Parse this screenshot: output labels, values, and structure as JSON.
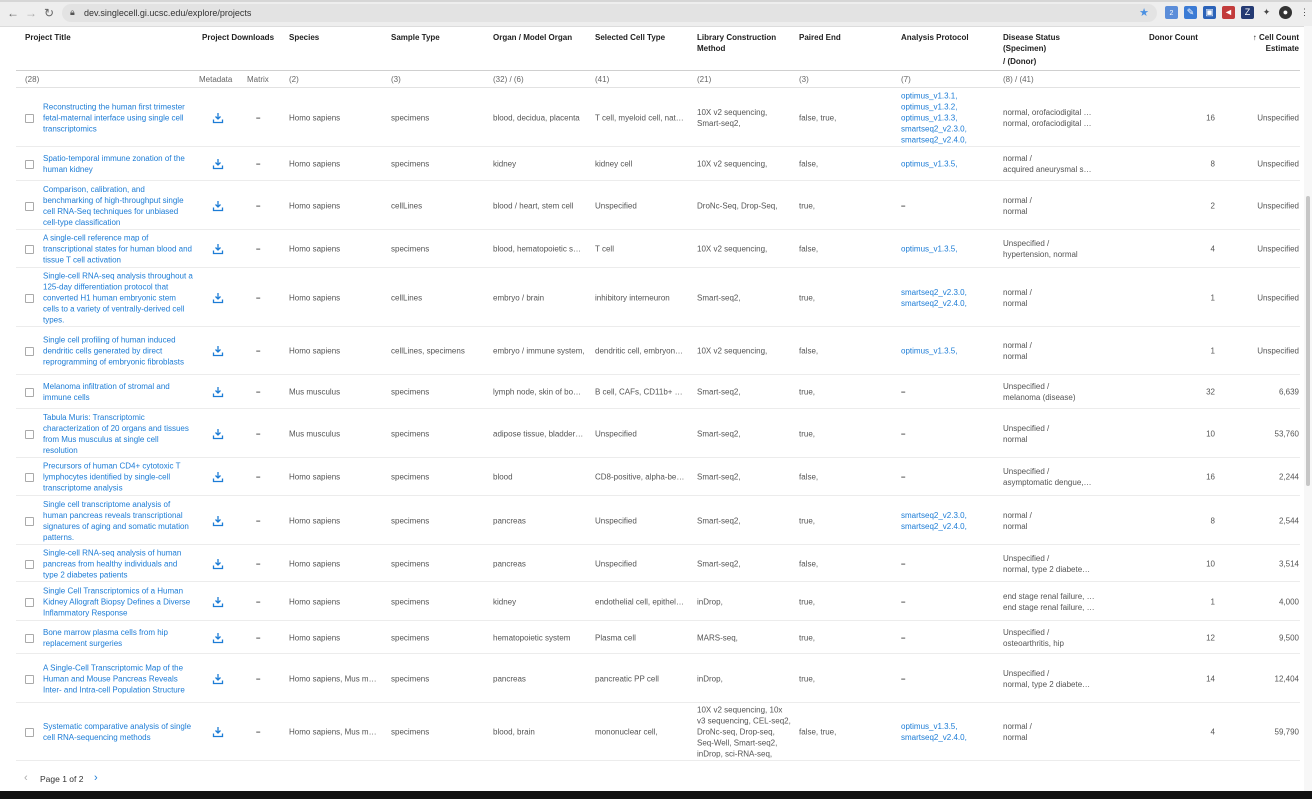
{
  "browser": {
    "url": "dev.singlecell.gi.ucsc.edu/explore/projects",
    "extension_badge": "2"
  },
  "table": {
    "headers": {
      "title": "Project Title",
      "downloads": "Project Downloads",
      "species": "Species",
      "sample_type": "Sample Type",
      "organ": "Organ / Model Organ",
      "cell_type": "Selected Cell Type",
      "library_line1": "Library Construction",
      "library_line2": "Method",
      "paired_end": "Paired End",
      "analysis": "Analysis Protocol",
      "disease_line1": "Disease Status",
      "disease_line2": "(Specimen)",
      "disease_line3": "/ (Donor)",
      "donor_count": "Donor Count",
      "cell_count_line1": "Cell Count",
      "cell_count_line2": "Estimate",
      "sort_arrow": "↑"
    },
    "subheaders": {
      "title": "(28)",
      "metadata": "Metadata",
      "matrix": "Matrix",
      "species": "(2)",
      "sample_type": "(3)",
      "organ": "(32) / (6)",
      "cell_type": "(41)",
      "library": "(21)",
      "paired_end": "(3)",
      "analysis": "(7)",
      "disease": "(8) / (41)"
    },
    "rows": [
      {
        "title": "Reconstructing the human first trimester fetal-maternal interface using single cell transcriptomics",
        "matrix": "–",
        "species": "Homo sapiens",
        "sample_type": "specimens",
        "organ": "blood, decidua, placenta",
        "cell_type": "T cell, myeloid cell, nat…",
        "library": "10X v2 sequencing, Smart-seq2,",
        "paired_end": "false, true,",
        "analysis": "optimus_v1.3.1, optimus_v1.3.2, optimus_v1.3.3, smartseq2_v2.3.0, smartseq2_v2.4.0,",
        "disease_a": "normal, orofaciodigital …",
        "disease_b": "normal, orofaciodigital …",
        "donors": "16",
        "cells": "Unspecified"
      },
      {
        "title": "Spatio-temporal immune zonation of the human kidney",
        "matrix": "–",
        "species": "Homo sapiens",
        "sample_type": "specimens",
        "organ": "kidney",
        "cell_type": "kidney cell",
        "library": "10X v2 sequencing,",
        "paired_end": "false,",
        "analysis": "optimus_v1.3.5,",
        "disease_a": "normal /",
        "disease_b": "acquired aneurysmal s…",
        "donors": "8",
        "cells": "Unspecified"
      },
      {
        "title": "Comparison, calibration, and benchmarking of high-throughput single cell RNA-Seq techniques for unbiased cell-type classification",
        "matrix": "–",
        "species": "Homo sapiens",
        "sample_type": "cellLines",
        "organ": "blood / heart, stem cell",
        "cell_type": "Unspecified",
        "library": "DroNc-Seq, Drop-Seq,",
        "paired_end": "true,",
        "analysis": "–",
        "disease_a": "normal /",
        "disease_b": "normal",
        "donors": "2",
        "cells": "Unspecified"
      },
      {
        "title": "A single-cell reference map of transcriptional states for human blood and tissue T cell activation",
        "matrix": "–",
        "species": "Homo sapiens",
        "sample_type": "specimens",
        "organ": "blood, hematopoietic s…",
        "cell_type": "T cell",
        "library": "10X v2 sequencing,",
        "paired_end": "false,",
        "analysis": "optimus_v1.3.5,",
        "disease_a": "Unspecified /",
        "disease_b": "hypertension, normal",
        "donors": "4",
        "cells": "Unspecified"
      },
      {
        "title": "Single-cell RNA-seq analysis throughout a 125-day differentiation protocol that converted H1 human embryonic stem cells to a variety of ventrally-derived cell types.",
        "matrix": "–",
        "species": "Homo sapiens",
        "sample_type": "cellLines",
        "organ": "embryo / brain",
        "cell_type": "inhibitory interneuron",
        "library": "Smart-seq2,",
        "paired_end": "true,",
        "analysis": "smartseq2_v2.3.0, smartseq2_v2.4.0,",
        "disease_a": "normal /",
        "disease_b": "normal",
        "donors": "1",
        "cells": "Unspecified"
      },
      {
        "title": "Single cell profiling of human induced dendritic cells generated by direct reprogramming of embryonic fibroblasts",
        "matrix": "–",
        "species": "Homo sapiens",
        "sample_type": "cellLines, specimens",
        "organ": "embryo / immune system,",
        "cell_type": "dendritic cell, embryon…",
        "library": "10X v2 sequencing,",
        "paired_end": "false,",
        "analysis": "optimus_v1.3.5,",
        "disease_a": "normal /",
        "disease_b": "normal",
        "donors": "1",
        "cells": "Unspecified"
      },
      {
        "title": "Melanoma infiltration of stromal and immune cells",
        "matrix": "–",
        "species": "Mus musculus",
        "sample_type": "specimens",
        "organ": "lymph node, skin of bo…",
        "cell_type": "B cell, CAFs, CD11b+ Ma…",
        "library": "Smart-seq2,",
        "paired_end": "true,",
        "analysis": "–",
        "disease_a": "Unspecified /",
        "disease_b": "melanoma (disease)",
        "donors": "32",
        "cells": "6,639"
      },
      {
        "title": "Tabula Muris: Transcriptomic characterization of 20 organs and tissues from Mus musculus at single cell resolution",
        "matrix": "–",
        "species": "Mus musculus",
        "sample_type": "specimens",
        "organ": "adipose tissue, bladder…",
        "cell_type": "Unspecified",
        "library": "Smart-seq2,",
        "paired_end": "true,",
        "analysis": "–",
        "disease_a": "Unspecified /",
        "disease_b": "normal",
        "donors": "10",
        "cells": "53,760"
      },
      {
        "title": "Precursors of human CD4+ cytotoxic T lymphocytes identified by single-cell transcriptome analysis",
        "matrix": "–",
        "species": "Homo sapiens",
        "sample_type": "specimens",
        "organ": "blood",
        "cell_type": "CD8-positive, alpha-be…",
        "library": "Smart-seq2,",
        "paired_end": "false,",
        "analysis": "–",
        "disease_a": "Unspecified /",
        "disease_b": "asymptomatic dengue,…",
        "donors": "16",
        "cells": "2,244"
      },
      {
        "title": "Single cell transcriptome analysis of human pancreas reveals transcriptional signatures of aging and somatic mutation patterns.",
        "matrix": "–",
        "species": "Homo sapiens",
        "sample_type": "specimens",
        "organ": "pancreas",
        "cell_type": "Unspecified",
        "library": "Smart-seq2,",
        "paired_end": "true,",
        "analysis": "smartseq2_v2.3.0, smartseq2_v2.4.0,",
        "disease_a": "normal /",
        "disease_b": "normal",
        "donors": "8",
        "cells": "2,544"
      },
      {
        "title": "Single-cell RNA-seq analysis of human pancreas from healthy individuals and type 2 diabetes patients",
        "matrix": "–",
        "species": "Homo sapiens",
        "sample_type": "specimens",
        "organ": "pancreas",
        "cell_type": "Unspecified",
        "library": "Smart-seq2,",
        "paired_end": "false,",
        "analysis": "–",
        "disease_a": "Unspecified /",
        "disease_b": "normal, type 2 diabete…",
        "donors": "10",
        "cells": "3,514"
      },
      {
        "title": "Single Cell Transcriptomics of a Human Kidney Allograft Biopsy Defines a Diverse Inflammatory Response",
        "matrix": "–",
        "species": "Homo sapiens",
        "sample_type": "specimens",
        "organ": "kidney",
        "cell_type": "endothelial cell, epithel…",
        "library": "inDrop,",
        "paired_end": "true,",
        "analysis": "–",
        "disease_a": "end stage renal failure, …",
        "disease_b": "end stage renal failure, …",
        "donors": "1",
        "cells": "4,000"
      },
      {
        "title": "Bone marrow plasma cells from hip replacement surgeries",
        "matrix": "–",
        "species": "Homo sapiens",
        "sample_type": "specimens",
        "organ": "hematopoietic system",
        "cell_type": "Plasma cell",
        "library": "MARS-seq,",
        "paired_end": "true,",
        "analysis": "–",
        "disease_a": "Unspecified /",
        "disease_b": "osteoarthritis, hip",
        "donors": "12",
        "cells": "9,500"
      },
      {
        "title": "A Single-Cell Transcriptomic Map of the Human and Mouse Pancreas Reveals Inter- and Intra-cell Population Structure",
        "matrix": "–",
        "species": "Homo sapiens, Mus m…",
        "sample_type": "specimens",
        "organ": "pancreas",
        "cell_type": "pancreatic PP cell",
        "library": "inDrop,",
        "paired_end": "true,",
        "analysis": "–",
        "disease_a": "Unspecified /",
        "disease_b": "normal, type 2 diabete…",
        "donors": "14",
        "cells": "12,404"
      },
      {
        "title": "Systematic comparative analysis of single cell RNA-sequencing methods",
        "matrix": "–",
        "species": "Homo sapiens, Mus m…",
        "sample_type": "specimens",
        "organ": "blood, brain",
        "cell_type": "mononuclear cell,",
        "library": "10X v2 sequencing, 10x v3 sequencing, CEL-seq2, DroNc-seq, Drop-seq, Seq-Well, Smart-seq2, inDrop, sci-RNA-seq,",
        "paired_end": "false, true,",
        "analysis": "optimus_v1.3.5, smartseq2_v2.4.0,",
        "disease_a": "normal /",
        "disease_b": "normal",
        "donors": "4",
        "cells": "59,790"
      }
    ]
  },
  "pagination": {
    "label": "Page 1 of 2",
    "prev": "‹",
    "next": "›"
  },
  "colors": {
    "link": "#1c7cd6",
    "accent": "#4a90e2"
  }
}
